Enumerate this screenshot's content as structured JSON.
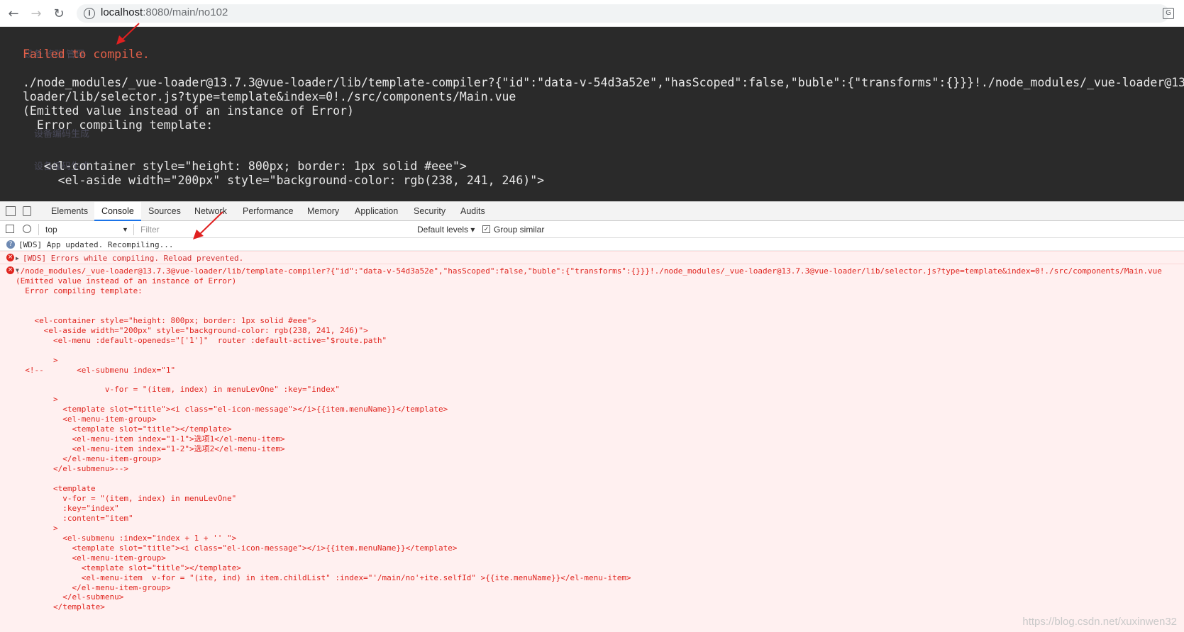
{
  "browser": {
    "url_host": "localhost",
    "url_rest": ":8080/main/no102"
  },
  "overlay": {
    "title": "Failed to compile.",
    "lines": [
      "./node_modules/_vue-loader@13.7.3@vue-loader/lib/template-compiler?{\"id\":\"data-v-54d3a52e\",\"hasScoped\":false,\"buble\":{\"transforms\":{}}}!./node_modules/_vue-loader@13.",
      "loader/lib/selector.js?type=template&index=0!./src/components/Main.vue",
      "(Emitted value instead of an instance of Error)",
      "  Error compiling template:",
      "",
      "",
      "   <el-container style=\"height: 800px; border: 1px solid #eee\">",
      "     <el-aside width=\"200px\" style=\"background-color: rgb(238, 241, 246)\">"
    ]
  },
  "devtools": {
    "tabs": [
      "Elements",
      "Console",
      "Sources",
      "Network",
      "Performance",
      "Memory",
      "Application",
      "Security",
      "Audits"
    ],
    "context": "top",
    "filter_placeholder": "Filter",
    "levels": "Default levels ▾",
    "group_similar": "Group similar"
  },
  "console": {
    "info": "[WDS] App updated. Recompiling...",
    "warn": "[WDS] Errors while compiling. Reload prevented.",
    "error_lines": [
      "./node_modules/_vue-loader@13.7.3@vue-loader/lib/template-compiler?{\"id\":\"data-v-54d3a52e\",\"hasScoped\":false,\"buble\":{\"transforms\":{}}}!./node_modules/_vue-loader@13.7.3@vue-loader/lib/selector.js?type=template&index=0!./src/components/Main.vue",
      "(Emitted value instead of an instance of Error)",
      "  Error compiling template:",
      "",
      "",
      "    <el-container style=\"height: 800px; border: 1px solid #eee\">",
      "      <el-aside width=\"200px\" style=\"background-color: rgb(238, 241, 246)\">",
      "        <el-menu :default-openeds=\"['1']\"  router :default-active=\"$route.path\"",
      "",
      "        >",
      "  <!--       <el-submenu index=\"1\"",
      "",
      "                   v-for = \"(item, index) in menuLevOne\" :key=\"index\"",
      "        >",
      "          <template slot=\"title\"><i class=\"el-icon-message\"></i>{{item.menuName}}</template>",
      "          <el-menu-item-group>",
      "            <template slot=\"title\"></template>",
      "            <el-menu-item index=\"1-1\">选项1</el-menu-item>",
      "            <el-menu-item index=\"1-2\">选项2</el-menu-item>",
      "          </el-menu-item-group>",
      "        </el-submenu>-->",
      "",
      "        <template",
      "          v-for = \"(item, index) in menuLevOne\"",
      "          :key=\"index\"",
      "          :content=\"item\"",
      "        >",
      "          <el-submenu :index=\"index + 1 + '' \">",
      "            <template slot=\"title\"><i class=\"el-icon-message\"></i>{{item.menuName}}</template>",
      "            <el-menu-item-group>",
      "              <template slot=\"title\"></template>",
      "              <el-menu-item  v-for = \"(ite, ind) in item.childList\" :index=\"'/main/no'+ite.selfId\" >{{ite.menuName}}</el-menu-item>",
      "            </el-menu-item-group>",
      "          </el-submenu>",
      "        </template>"
    ]
  },
  "watermark": "https://blog.csdn.net/xuxinwen32",
  "colors": {
    "overlay_bg": "#2a2a2a",
    "error_red": "#e0251f",
    "accent": "#1a73e8"
  }
}
